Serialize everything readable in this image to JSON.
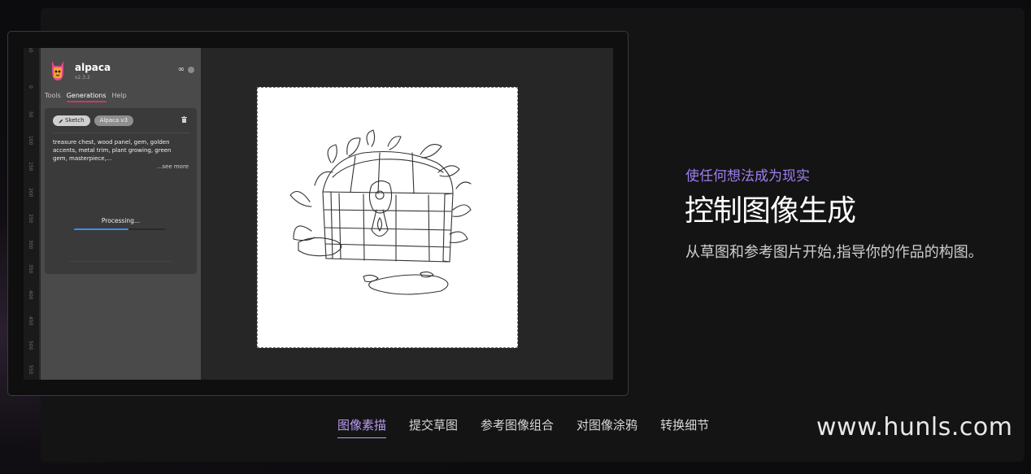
{
  "app": {
    "name": "alpaca",
    "version": "v2.3.2",
    "tabs": [
      "Tools",
      "Generations",
      "Help"
    ],
    "active_tab": "Generations",
    "ruler_labels": [
      "50",
      "0",
      "50",
      "100",
      "150",
      "200",
      "250",
      "300",
      "350",
      "400",
      "450",
      "500",
      "550"
    ],
    "card": {
      "chips": [
        "Sketch",
        "Alpaca v3"
      ],
      "prompt": "treasure chest, wood panel, gem, golden accents, metal trim, plant growing, green gem, masterpiece,...",
      "see_more": "...see more",
      "status": "Processing...",
      "progress": 0.6
    },
    "colors": {
      "accent": "#c23a72",
      "progress": "#3a8fe8"
    },
    "icons": [
      "alpaca-logo-icon",
      "infinity-icon",
      "status-dot-icon",
      "pencil-icon",
      "trash-icon"
    ]
  },
  "hero": {
    "eyebrow": "使任何想法成为现实",
    "headline": "控制图像生成",
    "description": "从草图和参考图片开始,指导你的作品的构图。",
    "colors": {
      "eyebrow": "#9d7ef0"
    }
  },
  "features": [
    {
      "label": "图像素描",
      "active": true
    },
    {
      "label": "提交草图",
      "active": false
    },
    {
      "label": "参考图像组合",
      "active": false
    },
    {
      "label": "对图像涂鸦",
      "active": false
    },
    {
      "label": "转换细节",
      "active": false
    }
  ],
  "watermark": "www.hunls.com"
}
